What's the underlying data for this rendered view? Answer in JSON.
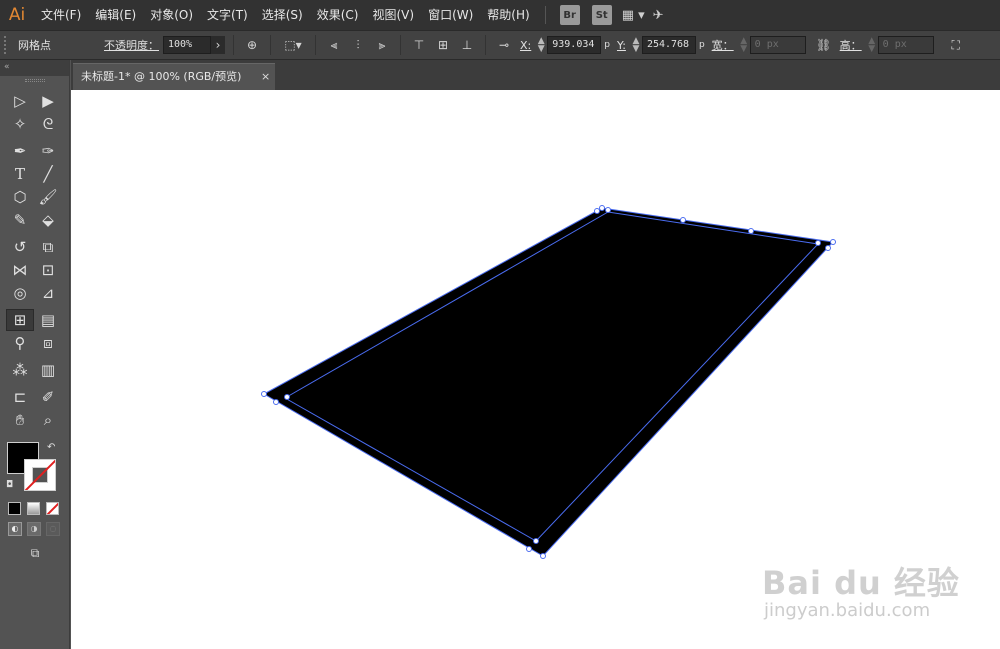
{
  "app": {
    "logo": "Ai",
    "accent": "#e38833"
  },
  "menu": [
    "文件(F)",
    "编辑(E)",
    "对象(O)",
    "文字(T)",
    "选择(S)",
    "效果(C)",
    "视图(V)",
    "窗口(W)",
    "帮助(H)"
  ],
  "menu_icons": {
    "bridge": "Br",
    "stock": "St",
    "layout": "layout-icon",
    "sync": "sync-icon"
  },
  "control": {
    "mode_label": "网格点",
    "opacity_label": "不透明度：",
    "opacity_value": "100%",
    "x_label": "X:",
    "x_value": "939.034",
    "x_unit": "p",
    "y_label": "Y:",
    "y_value": "254.768",
    "y_unit": "p",
    "width_label": "宽：",
    "width_value": "0 px",
    "height_label": "高：",
    "height_value": "0 px"
  },
  "toolbox": {
    "collapse": "«"
  },
  "document": {
    "tab_title": "未标题-1* @ 100% (RGB/预览)",
    "close": "×"
  },
  "swatches": {
    "fill": "#000000",
    "stroke": "none"
  },
  "watermark": {
    "title": "Bai du 经验",
    "url": "jingyan.baidu.com"
  }
}
